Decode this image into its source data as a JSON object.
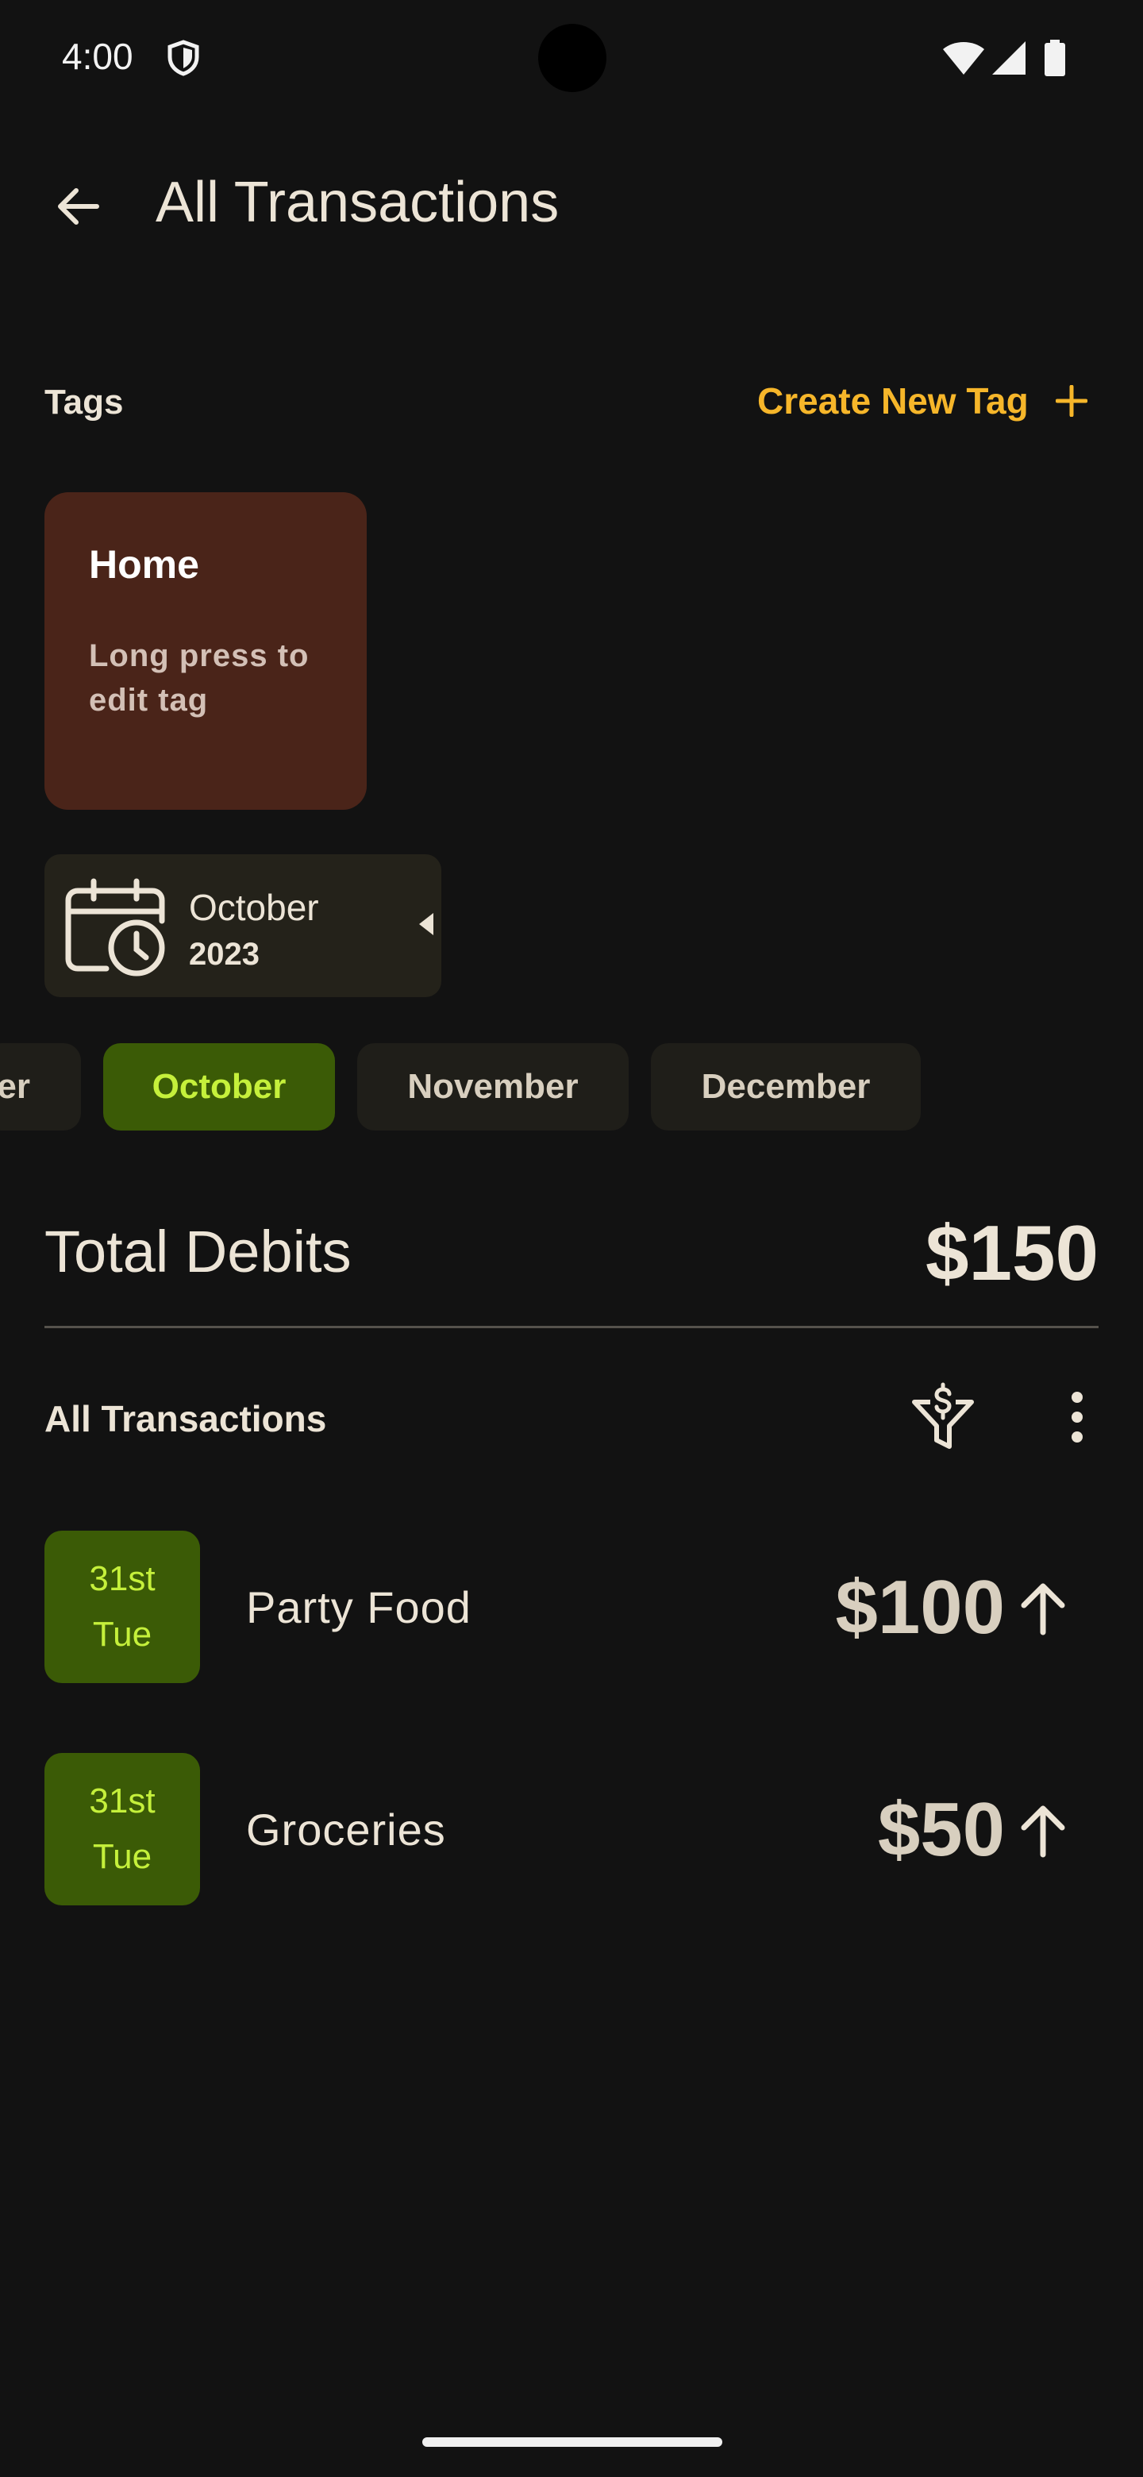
{
  "status_bar": {
    "time": "4:00",
    "icons": [
      "shield-icon",
      "wifi-icon",
      "signal-icon",
      "battery-icon"
    ]
  },
  "app_bar": {
    "back_icon": "arrow-back-icon",
    "title": "All Transactions"
  },
  "tags": {
    "label": "Tags",
    "create_label": "Create New Tag",
    "create_icon": "plus-icon",
    "items": [
      {
        "name": "Home",
        "hint": "Long press to edit tag"
      }
    ]
  },
  "month_picker": {
    "icon": "calendar-clock-icon",
    "month": "October",
    "year": "2023",
    "toggle_icon": "triangle-left-icon"
  },
  "month_chips": [
    {
      "label": "er",
      "selected": false
    },
    {
      "label": "October",
      "selected": true
    },
    {
      "label": "November",
      "selected": false
    },
    {
      "label": "December",
      "selected": false
    }
  ],
  "summary": {
    "label": "Total Debits",
    "value": "$150"
  },
  "transactions": {
    "title": "All Transactions",
    "filter_icon": "dollar-filter-icon",
    "menu_icon": "more-vert-icon",
    "items": [
      {
        "day": "31st",
        "weekday": "Tue",
        "name": "Party Food",
        "amount": "$100",
        "direction_icon": "arrow-up-icon"
      },
      {
        "day": "31st",
        "weekday": "Tue",
        "name": "Groceries",
        "amount": "$50",
        "direction_icon": "arrow-up-icon"
      }
    ]
  },
  "colors": {
    "background": "#121212",
    "accent_orange": "#f6b62a",
    "tag_card": "#4a2419",
    "selected_chip_bg": "#3b5b06",
    "selected_chip_text": "#c5f03b",
    "text": "#ece4d6"
  }
}
